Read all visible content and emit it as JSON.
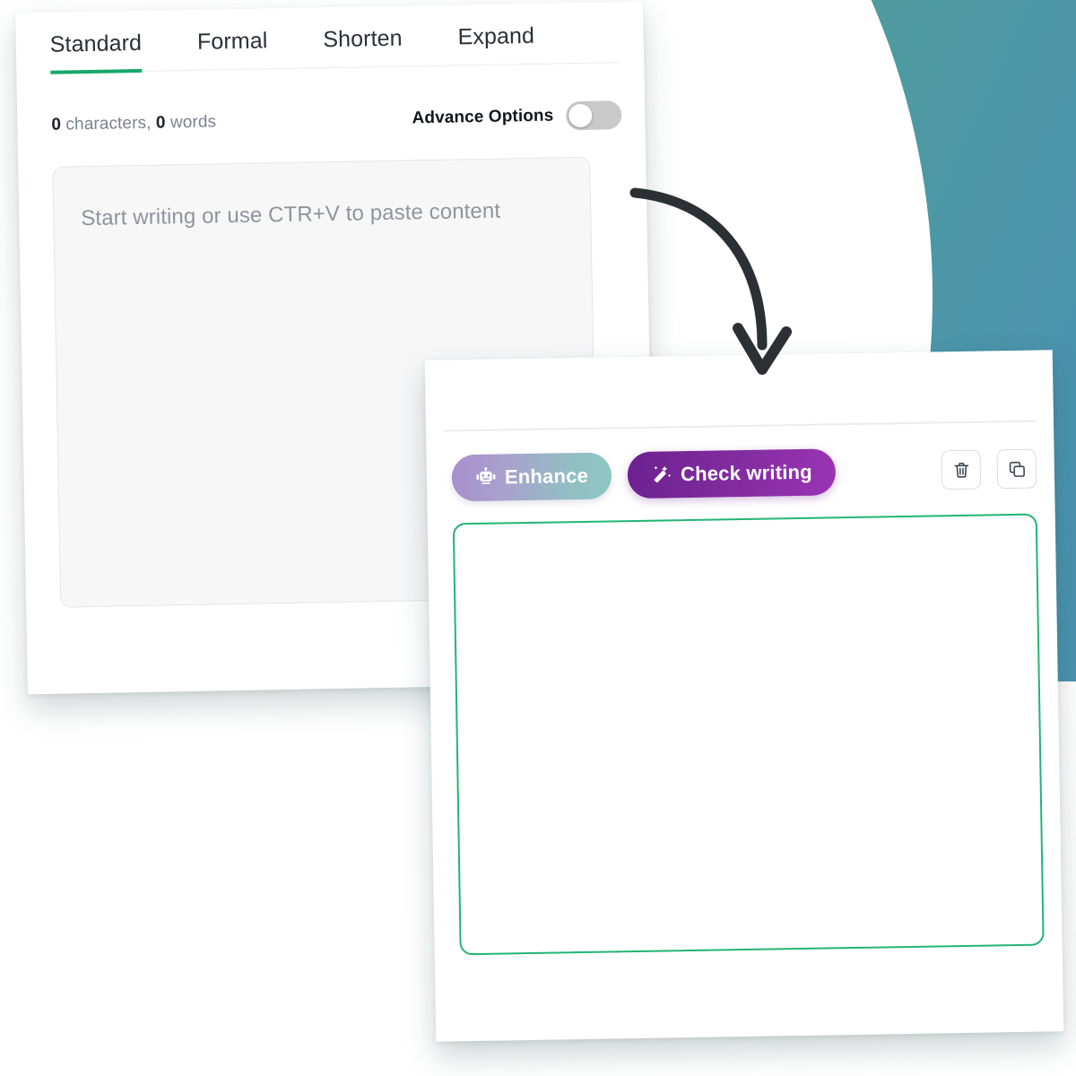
{
  "background": {
    "gradient_from": "#6aa84f",
    "gradient_to": "#4a91b0",
    "panel_color": "#ffffff"
  },
  "input_card": {
    "name": "text-input-card",
    "tabs": [
      {
        "id": "standard",
        "label": "Standard",
        "active": true
      },
      {
        "id": "formal",
        "label": "Formal",
        "active": false
      },
      {
        "id": "shorten",
        "label": "Shorten",
        "active": false
      },
      {
        "id": "expand",
        "label": "Expand",
        "active": false
      }
    ],
    "active_tab_indicator_color": "#16a868",
    "counts": {
      "characters_value": "0",
      "characters_label": "characters,",
      "words_value": "0",
      "words_label": "words"
    },
    "advance_options": {
      "label": "Advance Options",
      "state": "off"
    },
    "editor": {
      "placeholder": "Start writing or use CTR+V to paste content",
      "value": ""
    }
  },
  "output_card": {
    "name": "result-card",
    "actions": {
      "enhance": {
        "label": "Enhance",
        "icon": "robot-icon",
        "gradient_from": "#a78fcd",
        "gradient_to": "#8cc8c4"
      },
      "check_writing": {
        "label": "Check writing",
        "icon": "magic-wand-icon",
        "gradient_from": "#6d2190",
        "gradient_to": "#9a34b4"
      },
      "delete": {
        "icon": "trash-icon",
        "label": ""
      },
      "copy": {
        "icon": "copy-icon",
        "label": ""
      }
    },
    "editor": {
      "border_color": "#22b573",
      "value": ""
    }
  },
  "annotation": {
    "arrow": "curved-down-right-arrow",
    "color": "#2c2f33"
  }
}
